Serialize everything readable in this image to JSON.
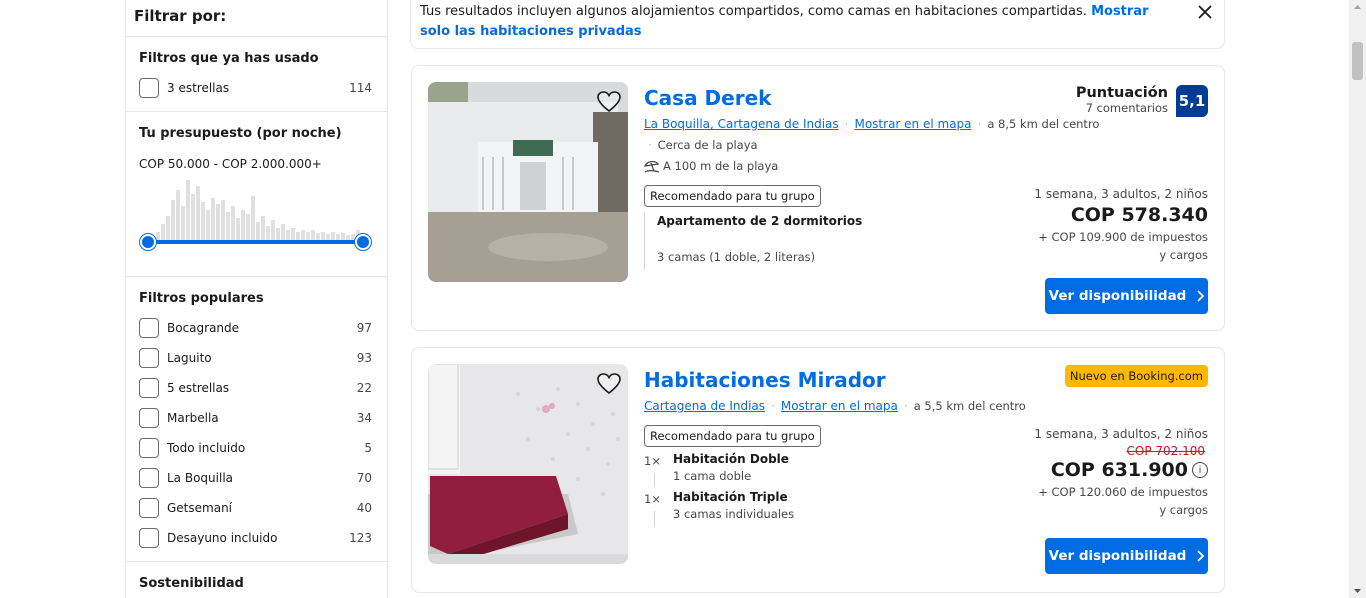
{
  "sidebar": {
    "title": "Filtrar por:",
    "used_filters": {
      "heading": "Filtros que ya has usado",
      "items": [
        {
          "label": "3 estrellas",
          "count": "114"
        }
      ]
    },
    "budget": {
      "heading": "Tu presupuesto (por noche)",
      "range": "COP 50.000 - COP 2.000.000+",
      "min_fraction": 0.0,
      "max_fraction": 1.0
    },
    "popular": {
      "heading": "Filtros populares",
      "items": [
        {
          "label": "Bocagrande",
          "count": "97"
        },
        {
          "label": "Laguito",
          "count": "93"
        },
        {
          "label": "5 estrellas",
          "count": "22"
        },
        {
          "label": "Marbella",
          "count": "34"
        },
        {
          "label": "Todo incluido",
          "count": "5"
        },
        {
          "label": "La Boquilla",
          "count": "70"
        },
        {
          "label": "Getsemaní",
          "count": "40"
        },
        {
          "label": "Desayuno incluido",
          "count": "123"
        }
      ]
    },
    "sustainability": {
      "heading": "Sostenibilidad"
    }
  },
  "notice": {
    "text": "Tus resultados incluyen algunos alojamientos compartidos, como camas en habitaciones compartidas.",
    "link": "Mostrar solo las habitaciones privadas"
  },
  "properties": [
    {
      "name": "Casa Derek",
      "location_link": "La Boquilla, Cartagena de Indias",
      "map_link": "Mostrar en el mapa",
      "distance": "a 8,5 km del centro",
      "near_beach": "Cerca de la playa",
      "beach_distance": "A 100 m de la playa",
      "recommended": "Recomendado para tu grupo",
      "room_title": "Apartamento de 2 dormitorios",
      "room_beds": "3 camas (1 doble, 2 literas)",
      "score_label": "Puntuación",
      "reviews": "7 comentarios",
      "score": "5,1",
      "stay": "1 semana, 3 adultos, 2 niños",
      "price": "COP 578.340",
      "taxes": "+ COP 109.900 de impuestos y cargos",
      "cta": "Ver disponibilidad"
    },
    {
      "name": "Habitaciones Mirador",
      "location_link": "Cartagena de Indias",
      "map_link": "Mostrar en el mapa",
      "distance": "a 5,5 km del centro",
      "badge": "Nuevo en Booking.com",
      "recommended": "Recomendado para tu grupo",
      "rooms": [
        {
          "qty": "1×",
          "title": "Habitación Doble",
          "beds": "1 cama doble"
        },
        {
          "qty": "1×",
          "title": "Habitación Triple",
          "beds": "3 camas individuales"
        }
      ],
      "stay": "1 semana, 3 adultos, 2 niños",
      "old_price": "COP 702.100",
      "price": "COP 631.900",
      "taxes": "+ COP 120.060 de impuestos y cargos",
      "cta": "Ver disponibilidad"
    }
  ]
}
